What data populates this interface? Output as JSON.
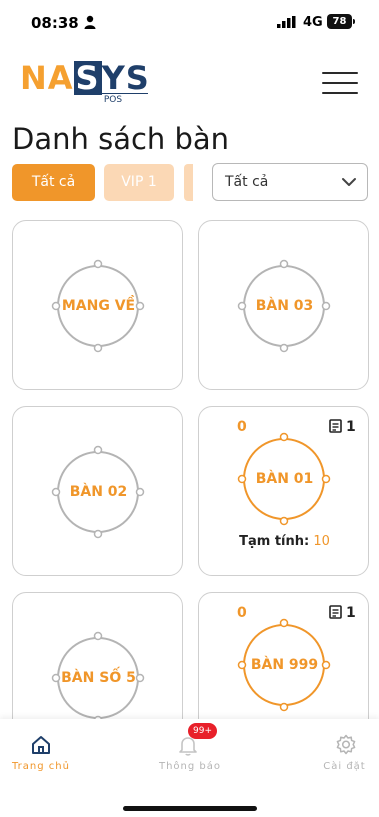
{
  "status_bar": {
    "time": "08:38",
    "network": "4G",
    "battery": "78"
  },
  "logo": {
    "part1": "NA",
    "letter_s": "S",
    "part2": "YS",
    "sub": "POS"
  },
  "page": {
    "title": "Danh sách bàn"
  },
  "filters": {
    "tabs": [
      "Tất cả",
      "VIP 1"
    ],
    "area_select": "Tất cả"
  },
  "tables": [
    {
      "name": "MANG VỀ",
      "status": "empty"
    },
    {
      "name": "BÀN 03",
      "status": "empty"
    },
    {
      "name": "BÀN 02",
      "status": "empty"
    },
    {
      "name": "BÀN 01",
      "status": "occupied",
      "guests": "0",
      "orders": "1",
      "subtotal_label": "Tạm tính:",
      "subtotal_value": "10"
    },
    {
      "name": "BÀN SỐ 5",
      "status": "empty"
    },
    {
      "name": "BÀN 999",
      "status": "occupied",
      "guests": "0",
      "orders": "1"
    }
  ],
  "bottom_nav": {
    "home": "Trang chủ",
    "notifications": "Thông báo",
    "notification_badge": "99+",
    "settings": "Cài đặt"
  },
  "colors": {
    "accent": "#f0962a",
    "accent_light": "#fbd8b5",
    "brand_navy": "#1f3f6a",
    "ring_empty": "#b4b4b4",
    "badge_red": "#e8202a"
  }
}
